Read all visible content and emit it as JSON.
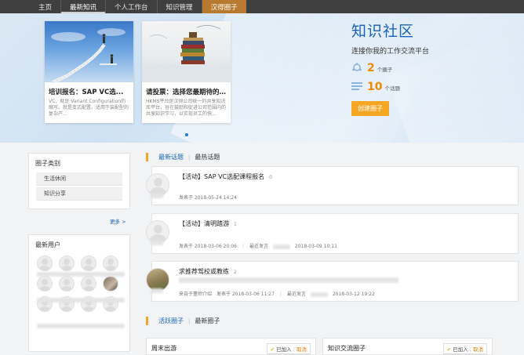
{
  "nav": {
    "items": [
      {
        "label": "主页"
      },
      {
        "label": "最新知讯"
      },
      {
        "label": "个人工作台"
      },
      {
        "label": "知识管理"
      },
      {
        "label": "汉得圈子"
      }
    ]
  },
  "hero": {
    "cards": [
      {
        "title": "培训报名：SAP VC选...",
        "desc": "VC，就是 Variant Configuration的缩写。就是变式配置。适用于装配型的复杂产..."
      },
      {
        "title": "请投票：选择您最期待的知...",
        "desc": "HKMS平台是汉得公司统一的共享知识库平台，旨在鼓励和促进公司范围内的共享知识学习，以实现员工的快..."
      }
    ],
    "title": "知识社区",
    "subtitle": "连接你我的工作交流平台",
    "circles_count": "2",
    "circles_unit": "个圈子",
    "topics_count": "10",
    "topics_unit": "个话题",
    "create_button": "创建圈子"
  },
  "sidebar": {
    "categories_title": "圈子类别",
    "categories": [
      {
        "label": "生活休闲"
      },
      {
        "label": "知识分享"
      }
    ],
    "more": "更多 >",
    "new_users_title": "最新用户"
  },
  "topics_tabs": {
    "tabs": [
      {
        "label": "最新话题"
      },
      {
        "label": "最热话题"
      }
    ]
  },
  "topics": [
    {
      "title": "【活动】SAP VC选配课程报名",
      "count": "0",
      "posted": "发表于 2018-05-24 14:24",
      "last_reply_label": "",
      "last_reply_time": "",
      "source": ""
    },
    {
      "title": "【活动】清明踏游",
      "count": "1",
      "posted": "发表于 2018-03-06 20:06",
      "last_reply_label": "最近发言",
      "last_reply_time": "2018-03-09 10:11",
      "source": ""
    },
    {
      "title": "求推荐驾校或教练",
      "count": "2",
      "posted": "发表于 2018-03-06 11:27",
      "last_reply_label": "最近发言",
      "last_reply_time": "2018-03-12 19:22",
      "source": "来自于董师介绍"
    }
  ],
  "circles_tabs": {
    "tabs": [
      {
        "label": "活跃圈子"
      },
      {
        "label": "最新圈子"
      }
    ]
  },
  "circles": [
    {
      "name": "周末出游",
      "joined": "已加入",
      "cancel": "取消"
    },
    {
      "name": "知识交流圈子",
      "joined": "已加入",
      "cancel": "取消"
    }
  ],
  "colors": {
    "accent": "#f5a623",
    "link": "#1b63b8",
    "nav_bg": "#3f3f3f",
    "nav_hot": "#b87a2e"
  }
}
